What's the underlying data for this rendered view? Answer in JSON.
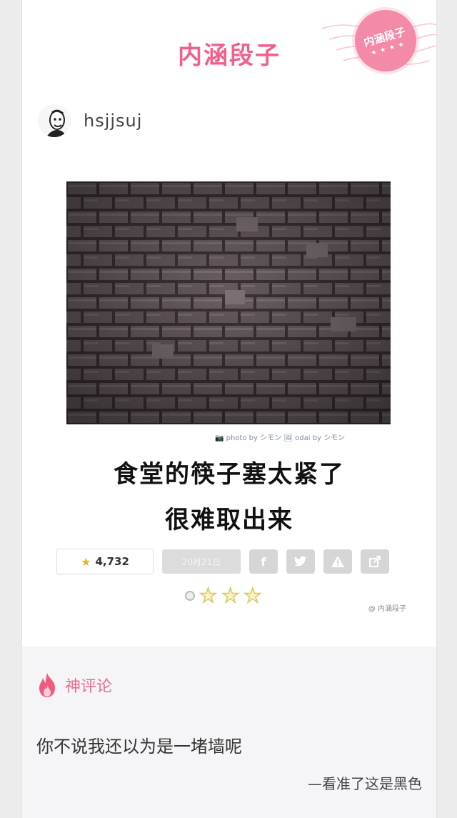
{
  "header": {
    "brand_title": "内涵段子",
    "stamp_text": "内涵段子",
    "stamp_stars": "★ ★ ★ ★"
  },
  "post": {
    "username": "hsjjsuj",
    "image_credit": "📷 photo by シモン  🖼 odai by シモン",
    "caption_lines": [
      "食堂的筷子塞太紧了",
      "很难取出来"
    ],
    "rating_count": "4,732",
    "date_label": "20月21日",
    "share_buttons": [
      "f",
      "t",
      "!",
      "↗"
    ],
    "watermark": "@ 内涵段子"
  },
  "comments": {
    "label": "神评论",
    "text": "你不说我还以为是一堵墙呢",
    "author": "—看准了这是黑色"
  },
  "colors": {
    "brand_pink": "#f0608a",
    "comment_pink": "#ee6b92",
    "bricks": "#4e4446"
  },
  "icons": {
    "stamp": "stamp-icon",
    "avatar": "avatar-icon",
    "fire": "fire-icon",
    "star": "star-icon",
    "facebook": "facebook-icon",
    "twitter": "twitter-icon",
    "warning": "warning-icon",
    "share": "share-icon"
  }
}
